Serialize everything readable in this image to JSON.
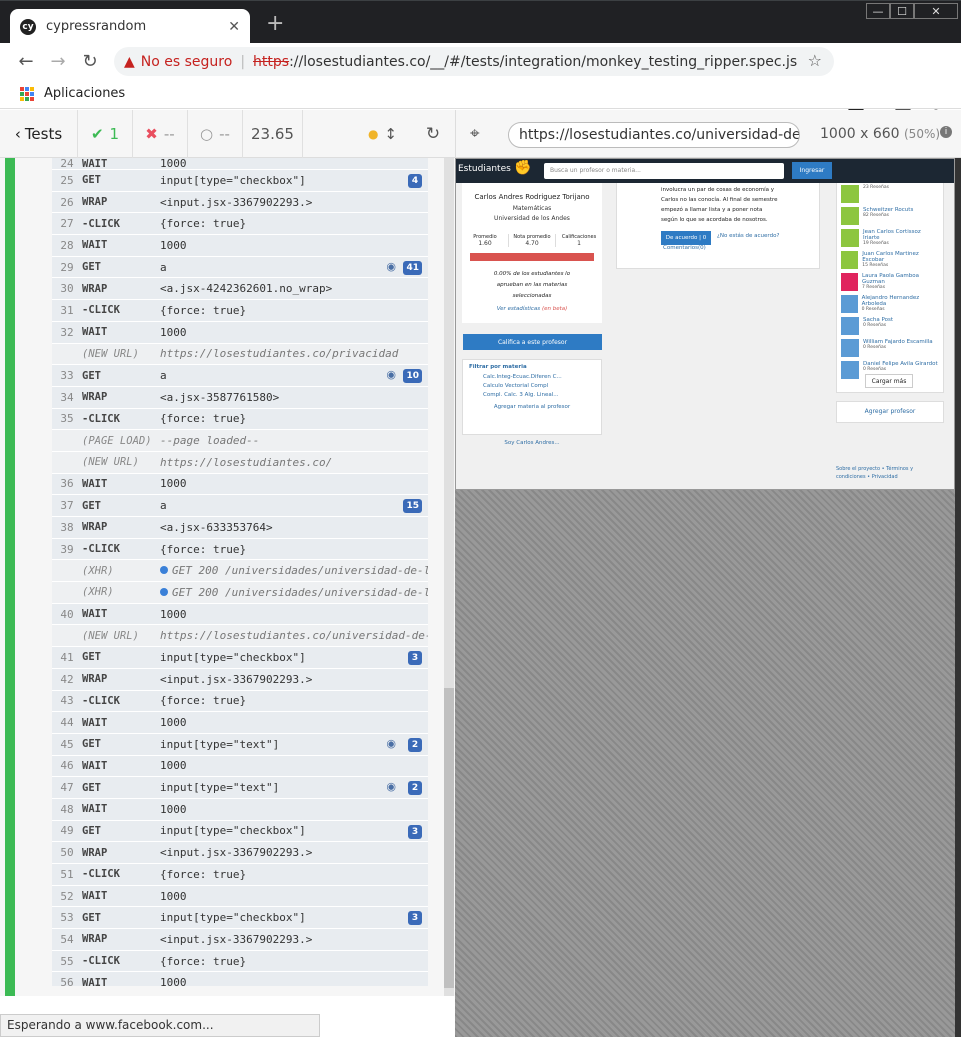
{
  "browser": {
    "tab_title": "cypressrandom",
    "favicon": "cy",
    "new_tab": "+",
    "close": "✕",
    "window": {
      "minimize": "—",
      "maximize": "☐",
      "close": "✕"
    },
    "not_secure": "No es seguro",
    "url_scheme": "https",
    "url_rest": "://losestudiantes.co/__/#/tests/integration/monkey_testing_ripper.spec.js",
    "bookmarks_apps": "Aplicaciones",
    "status": "Esperando a www.facebook.com..."
  },
  "cypress": {
    "tests_label": "Tests",
    "passed": "1",
    "failed": "--",
    "pending": "--",
    "duration": "23.65",
    "aut_url": "https://losestudiantes.co/universidad-de-los-an",
    "viewport": "1000 x 660",
    "scale": "(50%)"
  },
  "commands": [
    {
      "num": "24",
      "name": "WAIT",
      "msg": "1000",
      "partial": true
    },
    {
      "num": "25",
      "name": "GET",
      "msg": "input[type=\"checkbox\"]",
      "badge": "4"
    },
    {
      "num": "26",
      "name": "WRAP",
      "msg": "<input.jsx-3367902293.>"
    },
    {
      "num": "27",
      "name": "-CLICK",
      "msg": "{force: true}"
    },
    {
      "num": "28",
      "name": "WAIT",
      "msg": "1000"
    },
    {
      "num": "29",
      "name": "GET",
      "msg": "a",
      "badge": "41",
      "eye": true
    },
    {
      "num": "30",
      "name": "WRAP",
      "msg": "<a.jsx-4242362601.no_wrap>"
    },
    {
      "num": "31",
      "name": "-CLICK",
      "msg": "{force: true}"
    },
    {
      "num": "32",
      "name": "WAIT",
      "msg": "1000"
    },
    {
      "num": "",
      "name": "(NEW URL)",
      "msg": "https://losestudiantes.co/privacidad",
      "event": true
    },
    {
      "num": "33",
      "name": "GET",
      "msg": "a",
      "badge": "10",
      "eye": true
    },
    {
      "num": "34",
      "name": "WRAP",
      "msg": "<a.jsx-3587761580>"
    },
    {
      "num": "35",
      "name": "-CLICK",
      "msg": "{force: true}"
    },
    {
      "num": "",
      "name": "(PAGE LOAD)",
      "msg": "--page loaded--",
      "event": true
    },
    {
      "num": "",
      "name": "(NEW URL)",
      "msg": "https://losestudiantes.co/",
      "event": true
    },
    {
      "num": "36",
      "name": "WAIT",
      "msg": "1000"
    },
    {
      "num": "37",
      "name": "GET",
      "msg": "a",
      "badge": "15"
    },
    {
      "num": "38",
      "name": "WRAP",
      "msg": "<a.jsx-633353764>"
    },
    {
      "num": "39",
      "name": "-CLICK",
      "msg": "{force: true}"
    },
    {
      "num": "",
      "name": "(XHR)",
      "msg": "GET 200 /universidades/universidad-de-los-a...",
      "event": true,
      "xhr": true
    },
    {
      "num": "",
      "name": "(XHR)",
      "msg": "GET 200 /universidades/universidad-de-los-a...",
      "event": true,
      "xhr": true
    },
    {
      "num": "40",
      "name": "WAIT",
      "msg": "1000"
    },
    {
      "num": "",
      "name": "(NEW URL)",
      "msg": "https://losestudiantes.co/universidad-de-los-...",
      "event": true
    },
    {
      "num": "41",
      "name": "GET",
      "msg": "input[type=\"checkbox\"]",
      "badge": "3"
    },
    {
      "num": "42",
      "name": "WRAP",
      "msg": "<input.jsx-3367902293.>"
    },
    {
      "num": "43",
      "name": "-CLICK",
      "msg": "{force: true}"
    },
    {
      "num": "44",
      "name": "WAIT",
      "msg": "1000"
    },
    {
      "num": "45",
      "name": "GET",
      "msg": "input[type=\"text\"]",
      "badge": "2",
      "eye": true
    },
    {
      "num": "46",
      "name": "WAIT",
      "msg": "1000"
    },
    {
      "num": "47",
      "name": "GET",
      "msg": "input[type=\"text\"]",
      "badge": "2",
      "eye": true
    },
    {
      "num": "48",
      "name": "WAIT",
      "msg": "1000"
    },
    {
      "num": "49",
      "name": "GET",
      "msg": "input[type=\"checkbox\"]",
      "badge": "3"
    },
    {
      "num": "50",
      "name": "WRAP",
      "msg": "<input.jsx-3367902293.>"
    },
    {
      "num": "51",
      "name": "-CLICK",
      "msg": "{force: true}"
    },
    {
      "num": "52",
      "name": "WAIT",
      "msg": "1000"
    },
    {
      "num": "53",
      "name": "GET",
      "msg": "input[type=\"checkbox\"]",
      "badge": "3"
    },
    {
      "num": "54",
      "name": "WRAP",
      "msg": "<input.jsx-3367902293.>"
    },
    {
      "num": "55",
      "name": "-CLICK",
      "msg": "{force: true}"
    },
    {
      "num": "56",
      "name": "WAIT",
      "msg": "1000"
    }
  ],
  "aut": {
    "brand": "Estudiantes",
    "search_placeholder": "Busca un profesor o materia...",
    "login": "Ingresar",
    "professor_name": "Carlos Andres Rodriguez Torijano",
    "department": "Matemáticas",
    "university": "Universidad de los Andes",
    "stat_labels": [
      "Promedio",
      "Nota promedio",
      "Calificaciones"
    ],
    "stat_values": [
      "1.60",
      "4.70",
      "1"
    ],
    "approval_text": "0.00% de los estudiantes lo aprueban en las materias seleccionadas",
    "stats_link": "Ver estadísticas",
    "stats_beta": "(en beta)",
    "rate_button": "Califica a este profesor",
    "filter_title": "Filtrar por materia",
    "filters": [
      "Calc.Integ-Ecuac.Diferen C...",
      "Calculo Vectorial Compl",
      "Compl. Calc. 3 Alg. Lineal..."
    ],
    "add_subject": "Agregar materia al profesor",
    "soy_link": "Soy Carlos Andres...",
    "review_text": "involucra un par de cosas de economía y Carlos no las conocía. Al final de semestre empezó a llamar lista y a poner nota según lo que se acordaba de nosotros.",
    "agree_button": "De acuerdo | 0",
    "disagree_link": "¿No estás de acuerdo?",
    "comments_link": "Comentarios(0)",
    "professors": [
      {
        "name": "",
        "reviews": "23 Reseñas",
        "color": "#8dc63f"
      },
      {
        "name": "Schweitzer Rocuts",
        "reviews": "82 Reseñas",
        "color": "#8dc63f"
      },
      {
        "name": "Jean Carlos Cortissoz Iriarte",
        "reviews": "19 Reseñas",
        "color": "#8dc63f"
      },
      {
        "name": "Juan Carlos Martinez Escobar",
        "reviews": "15 Reseñas",
        "color": "#8dc63f"
      },
      {
        "name": "Laura Paola Gamboa Guzman",
        "reviews": "7 Reseñas",
        "color": "#e0245e"
      },
      {
        "name": "Alejandro Hernandez Arboleda",
        "reviews": "0 Reseñas",
        "color": "#5b9bd5"
      },
      {
        "name": "Sacha Post",
        "reviews": "0 Reseñas",
        "color": "#5b9bd5"
      },
      {
        "name": "William Fajardo Escamilla",
        "reviews": "0 Reseñas",
        "color": "#5b9bd5"
      },
      {
        "name": "Daniel Felipe Avila Girardot",
        "reviews": "0 Reseñas",
        "color": "#5b9bd5"
      }
    ],
    "load_more": "Cargar más",
    "add_professor": "Agregar profesor",
    "footer": "Sobre el proyecto • Términos y condiciones • Privacidad"
  }
}
